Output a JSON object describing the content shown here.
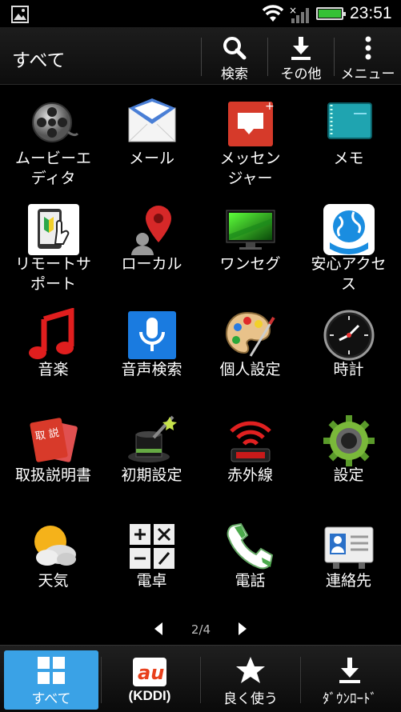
{
  "status_bar": {
    "time": "23:51",
    "icons": [
      "gallery-icon",
      "wifi-icon",
      "no-signal-icon",
      "battery-icon"
    ],
    "battery_color": "#35c135"
  },
  "action_bar": {
    "title": "すべて",
    "buttons": [
      {
        "label": "検索",
        "icon": "search-icon"
      },
      {
        "label": "その他",
        "icon": "download-icon"
      },
      {
        "label": "メニュー",
        "icon": "more-vert-icon"
      }
    ]
  },
  "apps": [
    {
      "label": "ムービーエ\nディタ",
      "icon": "film-reel-icon"
    },
    {
      "label": "メール",
      "icon": "mail-icon"
    },
    {
      "label": "メッセン\nジャー",
      "icon": "message-icon"
    },
    {
      "label": "メモ",
      "icon": "notebook-icon"
    },
    {
      "label": "リモートサ\nポート",
      "icon": "remote-support-icon"
    },
    {
      "label": "ローカル",
      "icon": "location-pin-icon"
    },
    {
      "label": "ワンセグ",
      "icon": "tv-icon"
    },
    {
      "label": "安心アクセ\nス",
      "icon": "globe-icon"
    },
    {
      "label": "音楽",
      "icon": "music-note-icon"
    },
    {
      "label": "音声検索",
      "icon": "microphone-icon"
    },
    {
      "label": "個人設定",
      "icon": "palette-icon"
    },
    {
      "label": "時計",
      "icon": "clock-icon"
    },
    {
      "label": "取扱説明書",
      "icon": "manual-book-icon"
    },
    {
      "label": "初期設定",
      "icon": "magic-hat-icon"
    },
    {
      "label": "赤外線",
      "icon": "infrared-icon"
    },
    {
      "label": "設定",
      "icon": "gear-icon"
    },
    {
      "label": "天気",
      "icon": "weather-icon"
    },
    {
      "label": "電卓",
      "icon": "calculator-icon"
    },
    {
      "label": "電話",
      "icon": "phone-icon"
    },
    {
      "label": "連絡先",
      "icon": "contacts-icon"
    }
  ],
  "pager": {
    "text": "2/4"
  },
  "bottom_tabs": [
    {
      "label": "すべて",
      "icon": "grid-icon",
      "active": true
    },
    {
      "label": "(KDDI)",
      "icon": "au-logo-icon",
      "logo_text": "au"
    },
    {
      "label": "良く使う",
      "icon": "star-icon"
    },
    {
      "label": "ﾀﾞｳﾝﾛｰﾄﾞ",
      "icon": "download-icon"
    }
  ],
  "colors": {
    "active_tab": "#3aa2e6",
    "background": "#000000"
  }
}
